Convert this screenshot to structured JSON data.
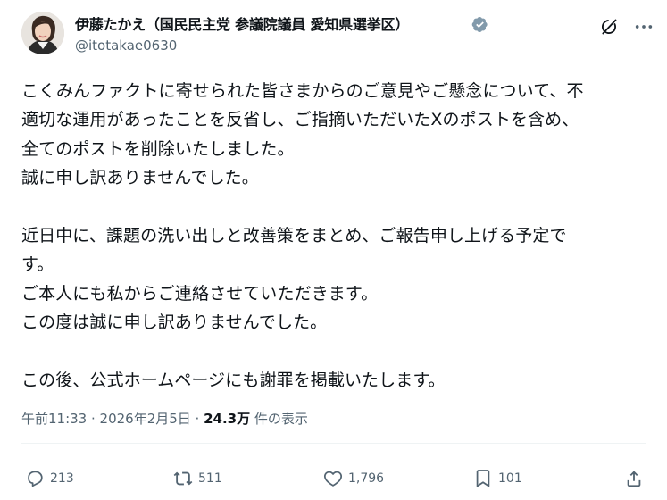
{
  "author": {
    "display_name": "伊藤たかえ（国民民主党 参議院議員 愛知県選挙区）",
    "handle": "@itotakae0630",
    "verified_badge_icon": "verified-badge-icon"
  },
  "post": {
    "paragraphs": [
      "こくみんファクトに寄せられた皆さまからのご意見やご懸念について、不\n適切な運用があったことを反省し、ご指摘いただいたXのポストを含め、\n全てのポストを削除いたしました。\n誠に申し訳ありませんでした。",
      "近日中に、課題の洗い出しと改善策をまとめ、ご報告申し上げる予定で\nす。\nご本人にも私からご連絡させていただきます。\nこの度は誠に申し訳ありませんでした。",
      "この後、公式ホームページにも謝罪を掲載いたします。"
    ],
    "timestamp": "午前11:33 · 2026年2月5日 · ",
    "views_count": "24.3万",
    "views_label": " 件の表示"
  },
  "actions": {
    "replies": "213",
    "reposts": "511",
    "likes": "1,796",
    "bookmarks": "101"
  },
  "colors": {
    "text": "#0f1419",
    "secondary": "#536471",
    "verified": "#829aab",
    "divider": "#eff3f4"
  }
}
